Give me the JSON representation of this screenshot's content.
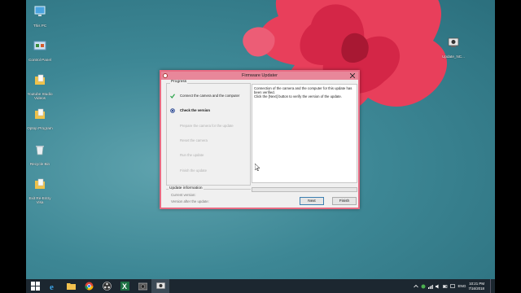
{
  "desktop": {
    "icons": [
      {
        "label": "This PC",
        "icon": "this-pc-icon"
      },
      {
        "label": "Control Panel",
        "icon": "control-panel-icon"
      },
      {
        "label": "Youtube Studio Videos",
        "icon": "folder-icon"
      },
      {
        "label": "Optop Program",
        "icon": "folder-icon"
      },
      {
        "label": "Recycle Bin",
        "icon": "recycle-bin-icon"
      },
      {
        "label": "Exit Re-Entry Visa",
        "icon": "folder-icon"
      }
    ],
    "right_icon": {
      "label": "Update_NC...",
      "icon": "updater-app-icon"
    }
  },
  "dialog": {
    "title": "Firmware Updater",
    "progress_label": "Progress",
    "steps": [
      {
        "label": "Connect the camera and the computer",
        "state": "done"
      },
      {
        "label": "Check the version",
        "state": "active"
      },
      {
        "label": "Prepare the camera for the update",
        "state": "pending"
      },
      {
        "label": "Reset the camera",
        "state": "pending"
      },
      {
        "label": "Run the update",
        "state": "pending"
      },
      {
        "label": "Finish the update",
        "state": "pending"
      }
    ],
    "message_line1": "Connection of the camera and the computer for this update has",
    "message_line2": "been verified.",
    "message_line3": "Click the [Next] button to verify the version of the update.",
    "progress_fraction": 0.0,
    "update_info": {
      "label": "Update information",
      "current_version": "Current version:",
      "version_after": "Version after the update:"
    },
    "buttons": {
      "next": "Next",
      "finish": "Finish"
    }
  },
  "taskbar": {
    "items": [
      {
        "name": "start",
        "icon": "windows-start-icon",
        "active": false
      },
      {
        "name": "ie",
        "icon": "internet-explorer-icon",
        "active": false
      },
      {
        "name": "explorer",
        "icon": "file-explorer-icon",
        "active": false
      },
      {
        "name": "chrome",
        "icon": "chrome-icon",
        "active": false
      },
      {
        "name": "obs",
        "icon": "obs-icon",
        "active": false
      },
      {
        "name": "excel",
        "icon": "excel-icon",
        "active": false
      },
      {
        "name": "snipping",
        "icon": "camera-app-icon",
        "active": false
      },
      {
        "name": "updater",
        "icon": "updater-app-icon",
        "active": true
      }
    ],
    "tray": {
      "language": "ENG",
      "time": "10:21 PM",
      "date": "7/16/2018"
    }
  },
  "colors": {
    "dialog_border": "#e86b83",
    "titlebar": "#e8879a",
    "check_green": "#2aa34a",
    "active_blue": "#1f3f8f"
  }
}
